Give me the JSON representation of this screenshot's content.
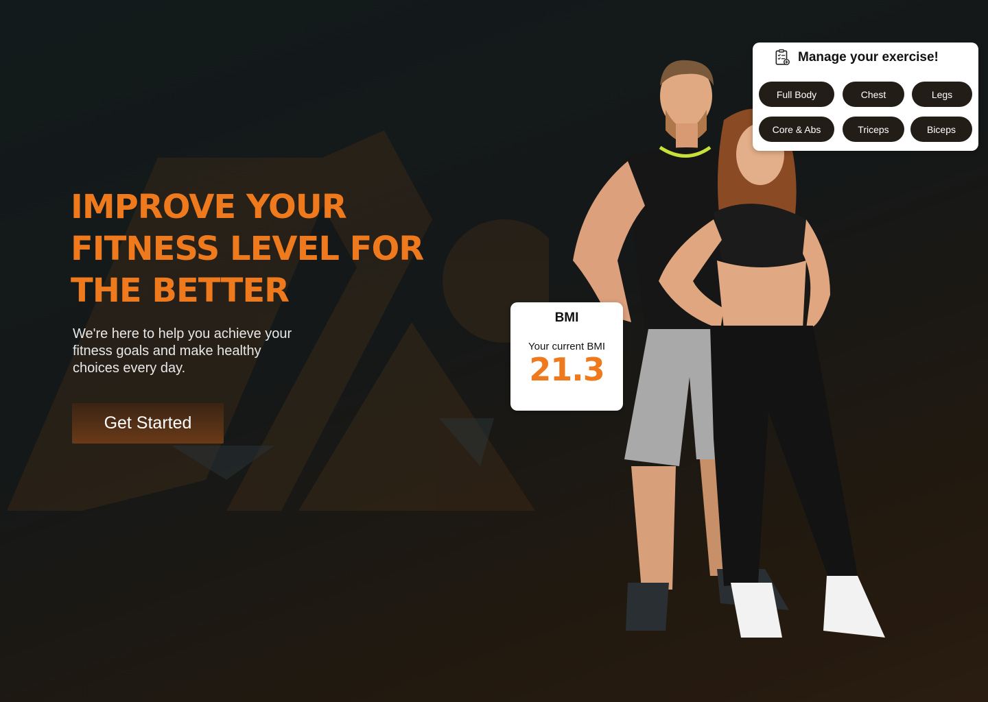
{
  "hero": {
    "title": "IMPROVE YOUR\nFITNESS LEVEL FOR\nTHE BETTER",
    "subtitle": "We're here to help you achieve your fitness goals and make healthy choices every day.",
    "cta_label": "Get Started"
  },
  "bmi": {
    "title": "BMI",
    "label": "Your current BMI",
    "value": "21.3"
  },
  "exercise": {
    "title": "Manage your exercise!",
    "chips": [
      "Full Body",
      "Chest",
      "Legs",
      "Core & Abs",
      "Triceps",
      "Biceps"
    ]
  },
  "colors": {
    "accent": "#ef7a1d",
    "chip_bg": "#231d17",
    "background": "#121a1b"
  },
  "icons": {
    "exercise_header": "clipboard-checklist-icon",
    "background_logo": "mountain-logo"
  }
}
